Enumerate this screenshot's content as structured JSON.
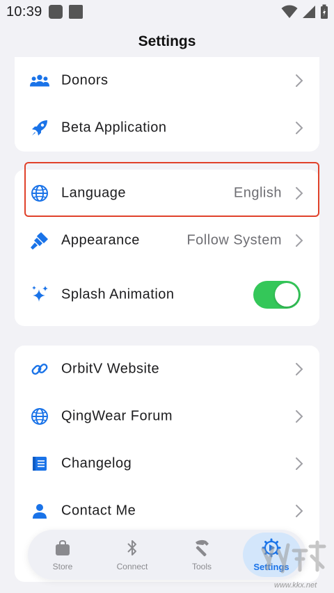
{
  "status_bar": {
    "time": "10:39"
  },
  "header": {
    "title": "Settings"
  },
  "group1": [
    {
      "label": "Donors",
      "icon": "people-icon"
    },
    {
      "label": "Beta Application",
      "icon": "rocket-icon"
    }
  ],
  "group2": {
    "language": {
      "label": "Language",
      "value": "English",
      "icon": "globe-icon"
    },
    "appearance": {
      "label": "Appearance",
      "value": "Follow System",
      "icon": "paintbrush-icon"
    },
    "splash": {
      "label": "Splash Animation",
      "icon": "sparkles-icon",
      "enabled": true
    }
  },
  "group3": [
    {
      "label": "OrbitV Website",
      "icon": "link-icon"
    },
    {
      "label": "QingWear Forum",
      "icon": "globe-icon"
    },
    {
      "label": "Changelog",
      "icon": "document-icon"
    },
    {
      "label": "Contact Me",
      "icon": "person-icon"
    }
  ],
  "tabbar": [
    {
      "label": "Store",
      "icon": "bag-icon",
      "active": false
    },
    {
      "label": "Connect",
      "icon": "bluetooth-icon",
      "active": false
    },
    {
      "label": "Tools",
      "icon": "hammer-icon",
      "active": false
    },
    {
      "label": "Settings",
      "icon": "gear-icon",
      "active": true
    }
  ],
  "watermark": {
    "text": "www.kkx.net"
  },
  "colors": {
    "accent": "#1a73e8",
    "toggle_on": "#34c759",
    "highlight": "#e0412a",
    "background": "#f2f2f6"
  }
}
